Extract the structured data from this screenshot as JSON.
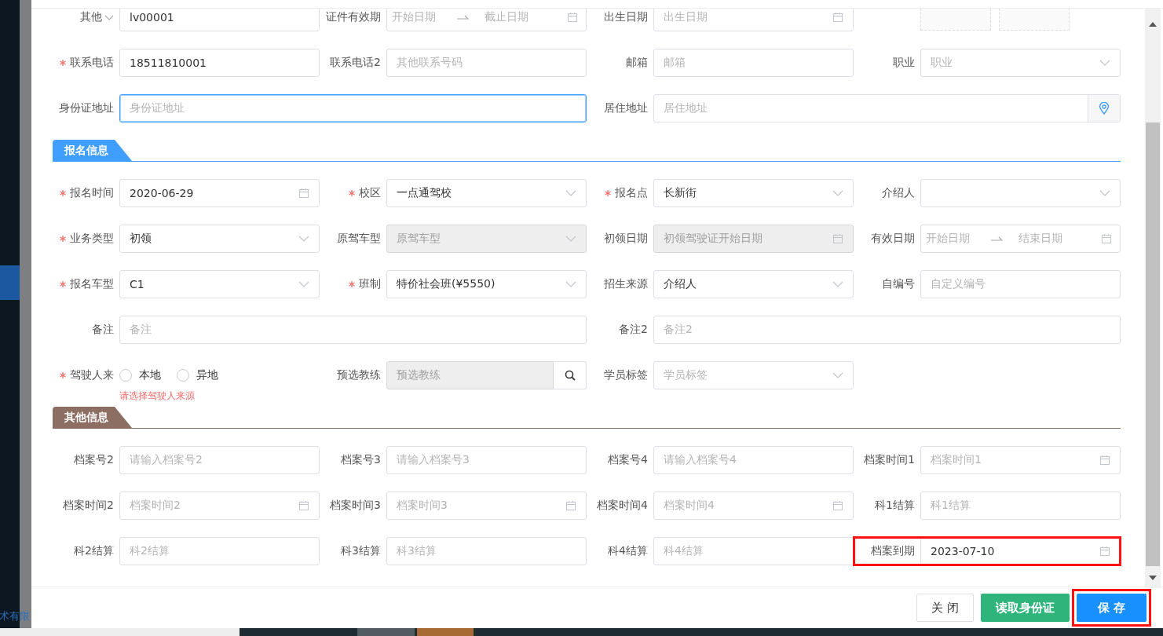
{
  "sidebar": {
    "footer_text": "术有限"
  },
  "form": {
    "items": [
      {
        "kind": "input",
        "label": "其他",
        "label_caret": true,
        "required": false,
        "disabled": false,
        "focused": false,
        "value": "lv00001"
      },
      {
        "kind": "range",
        "label": "证件有效期",
        "required": false,
        "disabled": false,
        "focused": false,
        "placeholder": "开始日期",
        "placeholder_end": "截止日期"
      },
      {
        "kind": "date",
        "label": "出生日期",
        "required": false,
        "disabled": false,
        "focused": false,
        "placeholder": "出生日期"
      },
      {
        "kind": "upload"
      },
      {
        "kind": "input",
        "label": "联系电话",
        "required": true,
        "disabled": false,
        "focused": false,
        "value": "18511810001"
      },
      {
        "kind": "input",
        "label": "联系电话2",
        "required": false,
        "disabled": false,
        "focused": false,
        "placeholder": "其他联系号码"
      },
      {
        "kind": "input",
        "label": "邮箱",
        "required": false,
        "disabled": false,
        "focused": false,
        "placeholder": "邮箱"
      },
      {
        "kind": "select",
        "label": "职业",
        "required": false,
        "disabled": false,
        "focused": false,
        "placeholder": "职业"
      },
      {
        "kind": "input",
        "label": "身份证地址",
        "wide": true,
        "required": false,
        "disabled": false,
        "focused": true,
        "placeholder": "身份证地址"
      },
      {
        "kind": "address",
        "label": "居住地址",
        "wide": true,
        "required": false,
        "disabled": false,
        "focused": false,
        "placeholder": "居住地址"
      },
      {
        "kind": "section",
        "title": "报名信息",
        "color": "#409eff"
      },
      {
        "kind": "date",
        "label": "报名时间",
        "required": true,
        "disabled": false,
        "focused": false,
        "value": "2020-06-29"
      },
      {
        "kind": "select",
        "label": "校区",
        "required": true,
        "disabled": false,
        "focused": false,
        "value": "一点通驾校"
      },
      {
        "kind": "select",
        "label": "报名点",
        "required": true,
        "disabled": false,
        "focused": false,
        "value": "长新街"
      },
      {
        "kind": "select",
        "label": "介绍人",
        "required": false,
        "disabled": false,
        "focused": false
      },
      {
        "kind": "select",
        "label": "业务类型",
        "required": true,
        "disabled": false,
        "focused": false,
        "value": "初领"
      },
      {
        "kind": "select",
        "label": "原驾车型",
        "required": false,
        "disabled": true,
        "focused": false,
        "placeholder": "原驾车型"
      },
      {
        "kind": "date",
        "label": "初领日期",
        "required": false,
        "disabled": true,
        "focused": false,
        "placeholder": "初领驾驶证开始日期"
      },
      {
        "kind": "range",
        "label": "有效日期",
        "required": false,
        "disabled": false,
        "focused": false,
        "placeholder": "开始日期",
        "placeholder_end": "结束日期"
      },
      {
        "kind": "select",
        "label": "报名车型",
        "required": true,
        "disabled": false,
        "focused": false,
        "value": "C1"
      },
      {
        "kind": "select",
        "label": "班制",
        "required": true,
        "disabled": false,
        "focused": false,
        "value": "特价社会班(¥5550)"
      },
      {
        "kind": "select",
        "label": "招生来源",
        "required": false,
        "disabled": false,
        "focused": false,
        "value": "介绍人"
      },
      {
        "kind": "input",
        "label": "自编号",
        "required": false,
        "disabled": false,
        "focused": false,
        "placeholder": "自定义编号"
      },
      {
        "kind": "input",
        "label": "备注",
        "wide": true,
        "required": false,
        "disabled": false,
        "focused": false,
        "placeholder": "备注"
      },
      {
        "kind": "input",
        "label": "备注2",
        "wide": true,
        "required": false,
        "disabled": false,
        "focused": false,
        "placeholder": "备注2"
      },
      {
        "kind": "radio",
        "label": "驾驶人来",
        "required": true,
        "options": [
          {
            "label": "本地",
            "selected": false
          },
          {
            "label": "异地",
            "selected": false
          }
        ],
        "error": "请选择驾驶人来源"
      },
      {
        "kind": "search",
        "label": "预选教练",
        "required": false,
        "disabled": true,
        "focused": false,
        "placeholder": "预选教练"
      },
      {
        "kind": "select",
        "label": "学员标签",
        "required": false,
        "disabled": false,
        "focused": false,
        "placeholder": "学员标签"
      },
      {
        "kind": "section",
        "title": "其他信息",
        "color": "#8d6e63"
      },
      {
        "kind": "input",
        "label": "档案号2",
        "required": false,
        "disabled": false,
        "focused": false,
        "placeholder": "请输入档案号2"
      },
      {
        "kind": "input",
        "label": "档案号3",
        "required": false,
        "disabled": false,
        "focused": false,
        "placeholder": "请输入档案号3"
      },
      {
        "kind": "input",
        "label": "档案号4",
        "required": false,
        "disabled": false,
        "focused": false,
        "placeholder": "请输入档案号4"
      },
      {
        "kind": "date",
        "label": "档案时间1",
        "required": false,
        "disabled": false,
        "focused": false,
        "placeholder": "档案时间1"
      },
      {
        "kind": "date",
        "label": "档案时间2",
        "required": false,
        "disabled": false,
        "focused": false,
        "placeholder": "档案时间2"
      },
      {
        "kind": "date",
        "label": "档案时间3",
        "required": false,
        "disabled": false,
        "focused": false,
        "placeholder": "档案时间3"
      },
      {
        "kind": "date",
        "label": "档案时间4",
        "required": false,
        "disabled": false,
        "focused": false,
        "placeholder": "档案时间4"
      },
      {
        "kind": "input",
        "label": "科1结算",
        "required": false,
        "disabled": false,
        "focused": false,
        "placeholder": "科1结算"
      },
      {
        "kind": "input",
        "label": "科2结算",
        "required": false,
        "disabled": false,
        "focused": false,
        "placeholder": "科2结算"
      },
      {
        "kind": "input",
        "label": "科3结算",
        "required": false,
        "disabled": false,
        "focused": false,
        "placeholder": "科3结算"
      },
      {
        "kind": "input",
        "label": "科4结算",
        "required": false,
        "disabled": false,
        "focused": false,
        "placeholder": "科4结算"
      },
      {
        "kind": "date",
        "label": "档案到期",
        "required": false,
        "disabled": false,
        "focused": false,
        "highlighted": true,
        "value": "2023-07-10"
      }
    ]
  },
  "footer": {
    "buttons": [
      {
        "label": "关 闭",
        "kind": "default",
        "highlighted": false
      },
      {
        "label": "读取身份证",
        "kind": "success",
        "highlighted": false
      },
      {
        "label": "保 存",
        "kind": "primary",
        "highlighted": true
      }
    ]
  }
}
